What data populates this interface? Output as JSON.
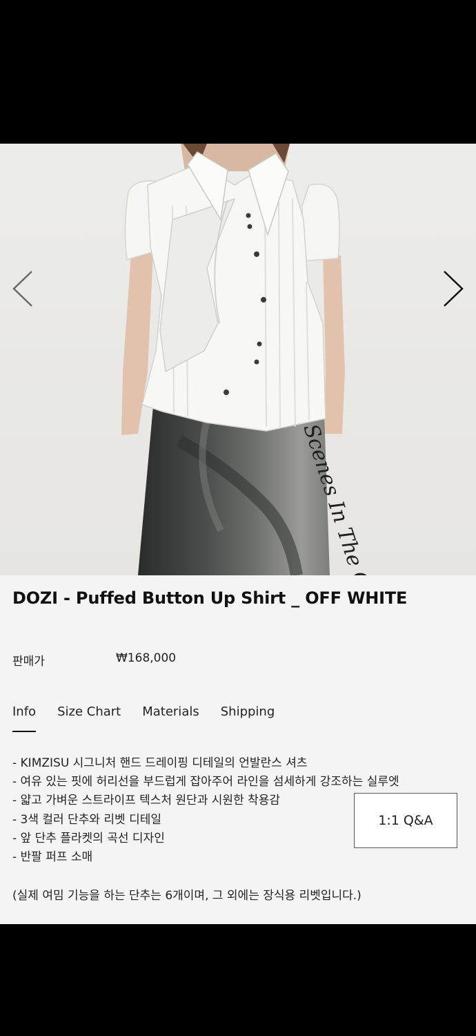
{
  "product": {
    "title": "DOZI - Puffed Button Up Shirt _ OFF WHITE",
    "price_label": "판매가",
    "price_value": "₩168,000"
  },
  "gallery": {
    "prev_icon": "chevron-left-icon",
    "next_icon": "chevron-right-icon",
    "skirt_print_text": "Scenes In The Ore"
  },
  "tabs": [
    {
      "label": "Info",
      "active": true
    },
    {
      "label": "Size Chart",
      "active": false
    },
    {
      "label": "Materials",
      "active": false
    },
    {
      "label": "Shipping",
      "active": false
    }
  ],
  "description": [
    "- KIMZISU 시그니처 핸드 드레이핑 디테일의 언발란스 셔츠",
    "- 여유 있는 핏에 허리선을 부드럽게 잡아주어 라인을 섬세하게 강조하는 실루엣",
    "- 얇고 가벼운 스트라이프 텍스처 원단과 시원한 착용감",
    "- 3색 컬러 단추와 리벳 디테일",
    "- 앞 단추 플라켓의 곡선 디자인",
    "- 반팔 퍼프 소매"
  ],
  "note": "(실제 여밈 기능을 하는 단추는 6개이며, 그 외에는 장식용 리벳입니다.)",
  "qa_button": {
    "label": "1:1 Q&A"
  },
  "colors": {
    "background": "#f4f4f4",
    "text": "#222222",
    "bars": "#000000"
  }
}
